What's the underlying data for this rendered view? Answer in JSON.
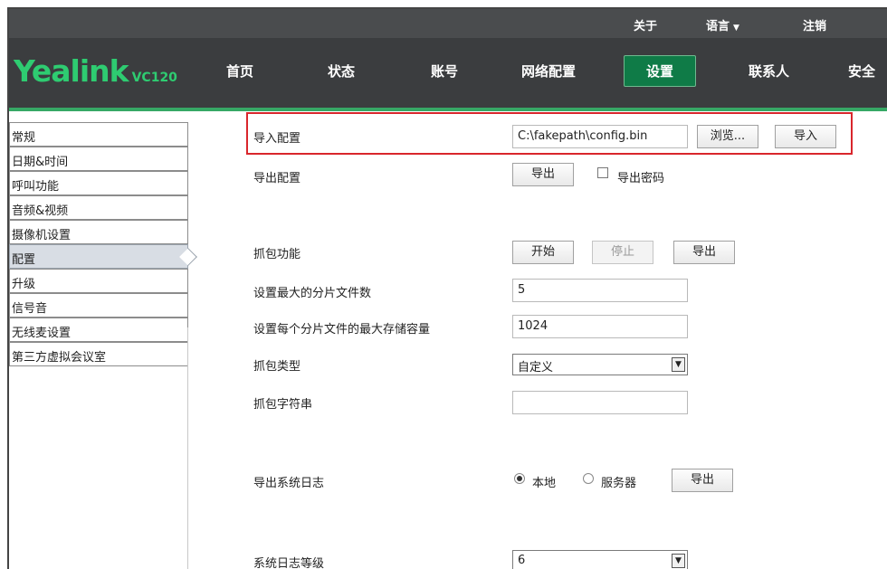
{
  "topbar": {
    "about": "关于",
    "language": "语言",
    "logout": "注销"
  },
  "brand": {
    "name": "Yealink",
    "model": "VC120"
  },
  "nav": {
    "items": [
      "首页",
      "状态",
      "账号",
      "网络配置",
      "设置",
      "联系人",
      "安全"
    ],
    "active": "设置"
  },
  "sidebar": {
    "items": [
      "常规",
      "日期&时间",
      "呼叫功能",
      "音频&视频",
      "摄像机设置",
      "配置",
      "升级",
      "信号音",
      "无线麦设置",
      "第三方虚拟会议室"
    ],
    "active_index": 5
  },
  "import_config": {
    "label": "导入配置",
    "file_value": "C:\\fakepath\\config.bin",
    "browse_label": "浏览...",
    "import_label": "导入"
  },
  "export_config": {
    "label": "导出配置",
    "export_label": "导出",
    "password_checkbox_label": "导出密码",
    "password_checked": false
  },
  "capture": {
    "label": "抓包功能",
    "start_label": "开始",
    "stop_label": "停止",
    "export_label": "导出"
  },
  "max_files": {
    "label": "设置最大的分片文件数",
    "value": "5"
  },
  "max_size": {
    "label": "设置每个分片文件的最大存储容量",
    "value": "1024"
  },
  "capture_type": {
    "label": "抓包类型",
    "value": "自定义"
  },
  "capture_string": {
    "label": "抓包字符串",
    "value": ""
  },
  "export_log": {
    "label": "导出系统日志",
    "option_local": "本地",
    "option_server": "服务器",
    "selected": "本地",
    "export_label": "导出"
  },
  "log_level": {
    "label": "系统日志等级",
    "value": "6"
  },
  "colors": {
    "accent_green": "#36a865",
    "active_tab": "#0f7b47",
    "highlight_red": "#d9262c",
    "topbar": "#4a4c4e",
    "navbar": "#3b3d3f"
  }
}
